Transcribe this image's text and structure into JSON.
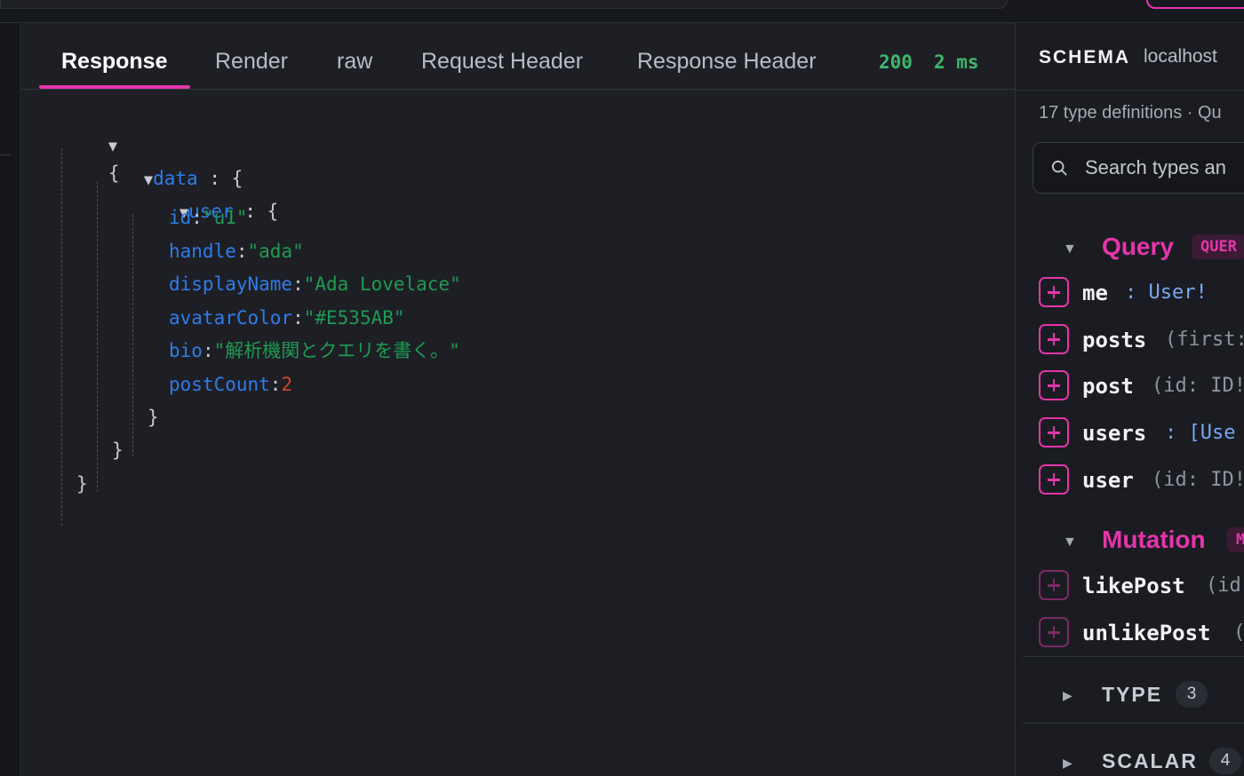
{
  "response_tabs": {
    "items": [
      "Response",
      "Render",
      "raw",
      "Request Header",
      "Response Header"
    ],
    "active": "Response"
  },
  "status": {
    "code": "200",
    "time": "2 ms"
  },
  "json_tree": {
    "open_brace": "{",
    "close_brace": "}",
    "colon": ":",
    "data_key": "data",
    "user_key": "user",
    "fields": [
      {
        "key": "id",
        "value": "\"u1\"",
        "kind": "string"
      },
      {
        "key": "handle",
        "value": "\"ada\"",
        "kind": "string"
      },
      {
        "key": "displayName",
        "value": "\"Ada Lovelace\"",
        "kind": "string"
      },
      {
        "key": "avatarColor",
        "value": "\"#E535AB\"",
        "kind": "string"
      },
      {
        "key": "bio",
        "value": "\"解析機関とクエリを書く。\"",
        "kind": "string"
      },
      {
        "key": "postCount",
        "value": "2",
        "kind": "number"
      }
    ]
  },
  "schema": {
    "title": "SCHEMA",
    "host": "localhost",
    "subtitle": "17 type definitions · Qu",
    "search_placeholder": "Search types an",
    "query": {
      "title": "Query",
      "badge": "QUER",
      "fields": [
        {
          "name": "me",
          "sig": ":  User!"
        },
        {
          "name": "posts",
          "sig": "(first:"
        },
        {
          "name": "post",
          "sig": "(id: ID!"
        },
        {
          "name": "users",
          "sig": ":  [Use"
        },
        {
          "name": "user",
          "sig": "(id: ID!"
        }
      ]
    },
    "mutation": {
      "title": "Mutation",
      "badge": "M",
      "fields": [
        {
          "name": "likePost",
          "sig": "(id"
        },
        {
          "name": "unlikePost",
          "sig": "("
        }
      ]
    },
    "sections": [
      {
        "title": "TYPE",
        "count": "3"
      },
      {
        "title": "SCALAR",
        "count": "4"
      }
    ]
  },
  "colors": {
    "accent": "#E535AB",
    "key": "#2F7CE8",
    "string": "#1F9A52",
    "number": "#D2452A",
    "status": "#3FB66B"
  },
  "icons": {
    "expand": "triangle-down-icon",
    "collapse": "triangle-right-icon",
    "search": "search-icon",
    "add": "plus-icon"
  }
}
